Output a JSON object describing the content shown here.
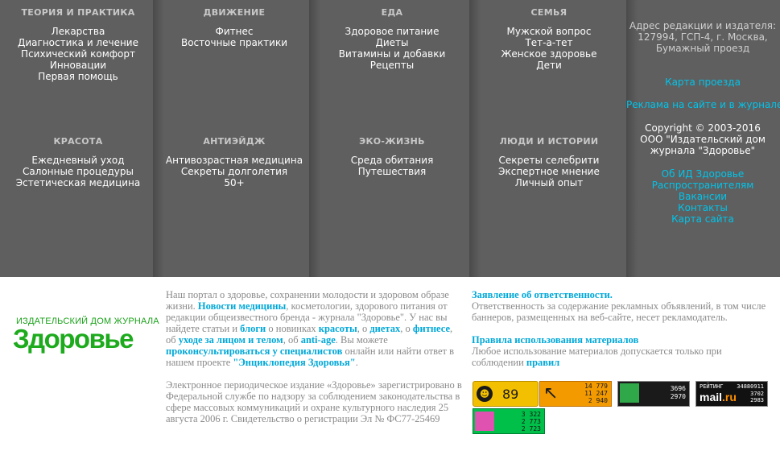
{
  "sections": {
    "health": {
      "head": "ТЕОРИЯ И ПРАКТИКА",
      "items": [
        "Лекарства",
        "Диагностика и лечение",
        "Психический комфорт",
        "Инновации",
        "Первая помощь"
      ]
    },
    "motion": {
      "head": "ДВИЖЕНИЕ",
      "items": [
        "Фитнес",
        "Восточные практики"
      ]
    },
    "food": {
      "head": "ЕДА",
      "items": [
        "Здоровое питание",
        "Диеты",
        "Витамины и добавки",
        "Рецепты"
      ]
    },
    "family": {
      "head": "СЕМЬЯ",
      "items": [
        "Мужской вопрос",
        "Тет-а-тет",
        "Женское здоровье",
        "Дети"
      ]
    },
    "beauty": {
      "head": "КРАСОТА",
      "items": [
        "Ежедневный уход",
        "Салонные процедуры",
        "Эстетическая медицина"
      ]
    },
    "antiage": {
      "head": "АНТИЭЙДЖ",
      "items": [
        "Антивозрастная медицина",
        "Секреты долголетия",
        "50+"
      ]
    },
    "eco": {
      "head": "ЭКО-ЖИЗНЬ",
      "items": [
        "Среда обитания",
        "Путешествия"
      ]
    },
    "people": {
      "head": "ЛЮДИ И ИСТОРИИ",
      "items": [
        "Секреты селебрити",
        "Экспертное мнение",
        "Личный опыт"
      ]
    }
  },
  "right": {
    "address": [
      "Адрес редакции и издателя:",
      "127994, ГСП-4, г. Москва,",
      "Бумажный проезд"
    ],
    "map_link": "Карта проезда",
    "ads_link": "Реклама на сайте и в журнале",
    "copyright": [
      "Copyright © 2003-2016",
      "ООО \"Издательский дом",
      "журнала \"Здоровье\""
    ],
    "links": [
      "Об ИД Здоровье",
      "Распространителям",
      "Вакансии",
      "Контакты",
      "Карта сайта"
    ]
  },
  "logo": {
    "subtitle": "ИЗДАТЕЛЬСКИЙ ДОМ ЖУРНАЛА",
    "name": "Здоровье"
  },
  "about": {
    "p1": "Наш портал о здоровье, сохранении молодости и здоровом образе жизни.",
    "news": "Новости медицины",
    "p2": ", косметологии, здорового питания от редакции общеизвестного бренда - журнала \"Здоровье\". У нас вы найдете статьи и",
    "blogs": "блоги",
    "p3": "о новинках",
    "beauty": "красоты",
    "p4": ", о",
    "diets": "диетах",
    "p5": ", о",
    "fitness": "фитнесе",
    "p6": ", об",
    "care": "уходе за лицом и телом",
    "p7": ", об",
    "antiage": "anti-age",
    "p8": ". Вы можете",
    "consult": "проконсультироваться у специалистов",
    "p9": "онлайн или найти ответ в нашем проекте",
    "encyclopedia": "\"Энциклопедия Здоровья\"",
    "p10": "."
  },
  "registration": "Электронное периодическое издание «Здоровье» зарегистрировано в Федеральной службе по надзору за соблюдением законодательства в сфере массовых коммуникаций и охране культурного наследия 25 августа 2006 г. Свидетельство о регистрации Эл № ФС77-25469",
  "responsibility": {
    "title": "Заявление об ответственности.",
    "text": "Ответственность за содержание рекламных объявлений, в том числе баннеров, размещенных на веб-сайте, несет рекламодатель."
  },
  "rules": {
    "title": "Правила использования материалов",
    "text": "Любое использование материалов допускается только при соблюдении",
    "link": "правил"
  },
  "counters": {
    "c1": {
      "value": "89"
    },
    "c2": {
      "values": [
        "14 779",
        "11 247",
        "2 940"
      ]
    },
    "c3": {
      "values": [
        "3696",
        "2970"
      ]
    },
    "c4": {
      "label": "РЕЙТИНГ",
      "label_num": "34880911",
      "brand": "mail",
      "brand_suffix": ".ru",
      "values": [
        "3702",
        "2983"
      ]
    },
    "c5": {
      "values": [
        "3 322",
        "2 773",
        "2 723"
      ]
    }
  },
  "colors": {
    "top_bg": "#5f5f5f",
    "link": "#00c4ea",
    "brand_green": "#1daa1d"
  }
}
